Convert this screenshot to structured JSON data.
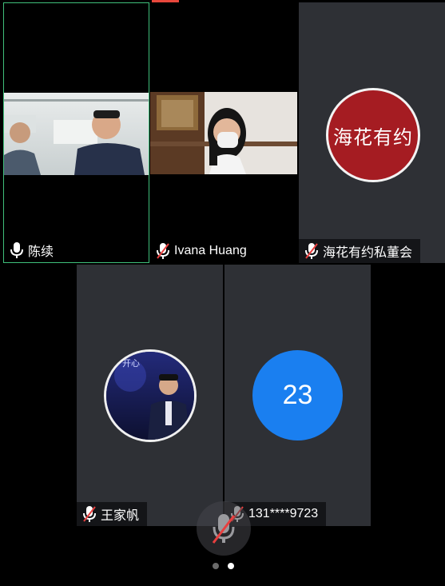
{
  "participants": [
    {
      "name": "陈续",
      "muted": false,
      "active_speaker": true
    },
    {
      "name": "Ivana Huang",
      "muted": true
    },
    {
      "name": "海花有约私董会",
      "muted": true,
      "avatar_text": "海花有约",
      "avatar_color": "#a51c22"
    },
    {
      "name": "王家帆",
      "muted": true,
      "avatar_caption": "开心"
    },
    {
      "name": "131****9723",
      "muted": true,
      "avatar_text": "23",
      "avatar_color": "#1a7ff0"
    }
  ],
  "colors": {
    "tile_bg": "#2e3035",
    "active_border": "#3fbf7a",
    "muted_slash": "#e83f3f",
    "top_accent": "#e8473c"
  },
  "pager": {
    "page_count": 2,
    "current_page": 2
  },
  "controls": {
    "self_mic_muted": true
  }
}
